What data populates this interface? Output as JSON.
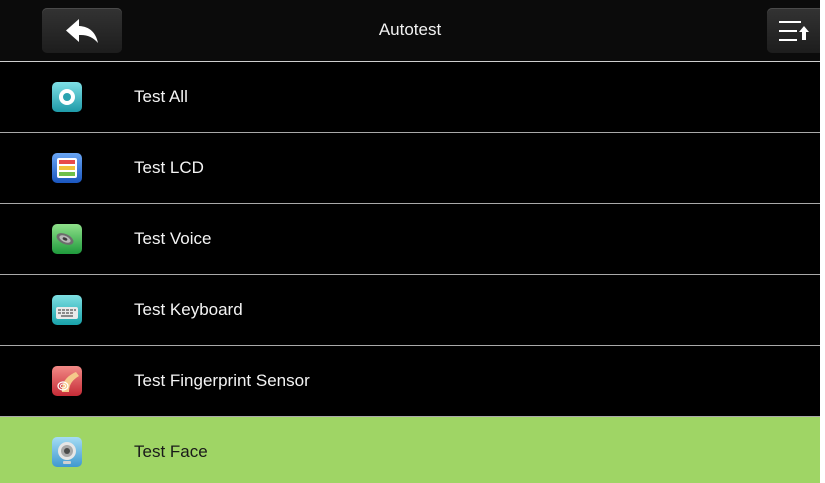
{
  "header": {
    "title": "Autotest",
    "back_icon": "back-arrow-icon",
    "menu_icon": "sort-menu-icon"
  },
  "items": [
    {
      "label": "Test All",
      "icon": "test-all-icon",
      "icon_color": "#3fb8c4"
    },
    {
      "label": "Test LCD",
      "icon": "lcd-icon",
      "icon_color": "#2c6fd6"
    },
    {
      "label": "Test Voice",
      "icon": "speaker-icon",
      "icon_color": "#2ea84a"
    },
    {
      "label": "Test Keyboard",
      "icon": "keyboard-icon",
      "icon_color": "#26b3b8"
    },
    {
      "label": "Test Fingerprint Sensor",
      "icon": "fingerprint-icon",
      "icon_color": "#d8414a"
    },
    {
      "label": "Test Face",
      "icon": "face-camera-icon",
      "icon_color": "#5fb9de",
      "selected": true
    }
  ],
  "colors": {
    "background": "#000000",
    "selected_row": "#9fd565",
    "divider": "#a9a9a9",
    "text": "#f4f4f4"
  }
}
